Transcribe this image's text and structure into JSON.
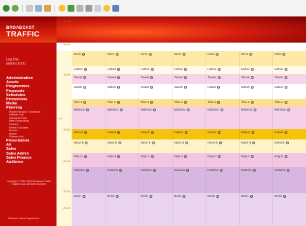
{
  "app": {
    "brand_top": "BROADCAST",
    "brand_main": "TRAFFIC"
  },
  "toolbar": {
    "icons": [
      "back-icon",
      "forward-icon",
      "stop-icon",
      "refresh-icon",
      "home-icon",
      "favorites-icon",
      "history-icon",
      "mail-icon",
      "print-icon",
      "edit-icon",
      "folder-icon"
    ]
  },
  "sidebar": {
    "login_line1": "Log Out",
    "login_line2": "admin (XXX)",
    "menu": [
      {
        "label": "Administration"
      },
      {
        "label": "Assets"
      },
      {
        "label": "Programmes"
      },
      {
        "label": "Proposals"
      },
      {
        "label": "Schedules"
      },
      {
        "label": "Promotions"
      },
      {
        "label": "Media"
      },
      {
        "label": "Planning"
      }
    ],
    "submenu": [
      "Planner Board / Schedule",
      "Affiliate Port",
      "Schedule Plan",
      "New Scheduling",
      "Planner",
      "Rules & Quotas",
      "Booker",
      "Import",
      "Planner List"
    ],
    "menu2": [
      {
        "label": "Presentation"
      },
      {
        "label": "Air"
      },
      {
        "label": "Sales"
      },
      {
        "label": "Sales Admin"
      },
      {
        "label": "Sales Finance"
      },
      {
        "label": "Audience"
      }
    ],
    "copyright": "Copyright © 2001-2004 Broadcast Traffic Systems Ltd. All rights reserved",
    "footer_link": "Software License Agreement"
  },
  "schedule": {
    "day_label": "Fri",
    "times": [
      "17:00",
      "18:00",
      "19:00",
      "20:00",
      "21:00",
      "22:00",
      "23:00"
    ],
    "rows": [
      {
        "color": "#ffe9a6",
        "cells": [
          "Isens",
          "Isens",
          "Isens",
          "Isens",
          "Isens",
          "Isens",
          "Isens"
        ]
      },
      {
        "color": "#fffbe8",
        "cells": [
          "Lathos",
          "Lathos",
          "Lathos",
          "Lathos",
          "Lathos",
          "Lathos",
          "Lathos"
        ]
      },
      {
        "color": "#f8d4e8",
        "cells": [
          "Taveat",
          "Taveat",
          "Taveat",
          "Taveat",
          "Taveat",
          "Taveat",
          "Taveat"
        ]
      },
      {
        "color": "#ffffff",
        "cells": [
          "Isabuli",
          "Isabuli",
          "Isabuli",
          "Isabuli",
          "Isabuli",
          "Isabuli",
          "Isabuli"
        ]
      },
      {
        "color": "#fde08f",
        "cells": [
          "Tilav a",
          "Tilav a",
          "Tilav a",
          "Tilav a",
          "Tilav a",
          "Tilav a",
          "Tilav a"
        ]
      },
      {
        "color": "#f4cfe5",
        "cells": [
          "Mahmou",
          "Mahmou",
          "Mahmou",
          "Mahmou",
          "Mahmou",
          "Mahmou",
          "Mahmou"
        ]
      },
      {
        "color": "#f7c20c",
        "cells": [
          "Natsuil",
          "Natsuil",
          "Natsuil",
          "Natsuil",
          "Natsuil",
          "Natsuil",
          "Natsuil"
        ]
      },
      {
        "color": "#fff4c8",
        "cells": [
          "Navvi B",
          "Navvi B",
          "Navvi B",
          "Navvi B",
          "Navvi B",
          "Navvi B",
          "Navvi B"
        ]
      },
      {
        "color": "#f2c6e2",
        "cells": [
          "Noly H",
          "Noly H",
          "Noly H",
          "Noly H",
          "Noly H",
          "Noly H",
          "Noly H"
        ]
      },
      {
        "color": "#d7b6e0",
        "cells": [
          "Katarina",
          "Katarina",
          "Katarina",
          "Katarina",
          "Katarina",
          "Katarina",
          "Katarina"
        ]
      },
      {
        "color": "#e9d3ef",
        "cells": [
          "Berlin",
          "Berlin",
          "Berlin",
          "Berlin",
          "Berlin",
          "Berlin",
          "Berlin"
        ]
      }
    ]
  }
}
